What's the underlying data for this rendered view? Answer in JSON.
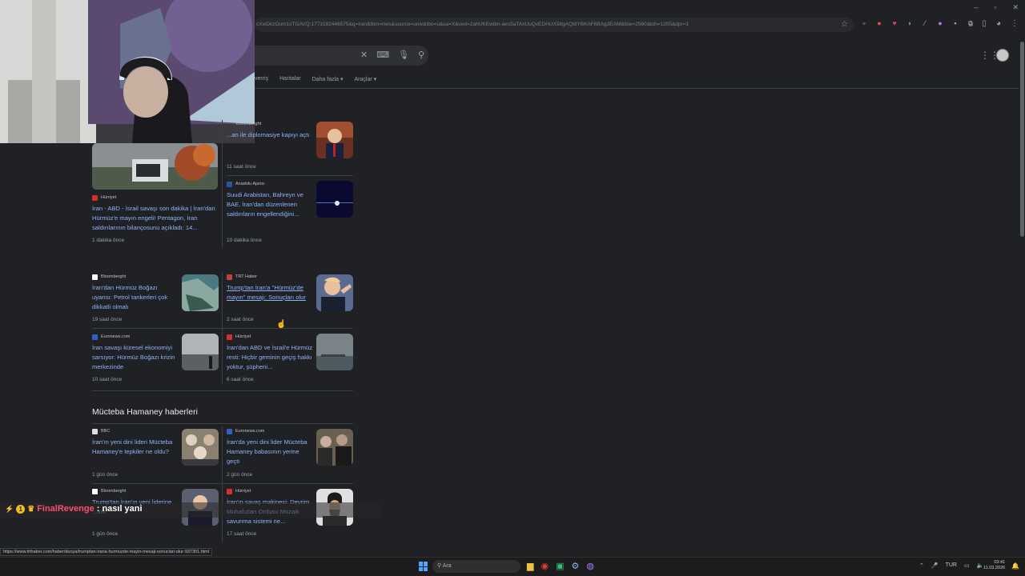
{
  "browser": {
    "address_url": "cXwDkzOum1sTGAVQ:1773182446575&q=iran&tbm=nws&source=univ&tbo=u&sa=X&ved=2ahUKEwibn-aes5aTAxUuQvEDHUX58gAQt8YBKAF6BAg3EAM&biw=2560&bih=1305&dpr=1",
    "window_controls": [
      "–",
      "▫",
      "✕"
    ]
  },
  "search": {
    "clear_icon": "close-icon",
    "tabs": [
      "verriş",
      "Haritalar",
      "Daha fazla ▾",
      "Araçlar ▾"
    ]
  },
  "cards": [
    {
      "source": "Bloomberght",
      "title": "...an ile diplomasiye kapıyı açtı",
      "time": "11 saat önce"
    },
    {
      "source": "Hürriyet",
      "title": "İran - ABD - İsrail savaşı son dakika | İran'dan Hürmüz'e mayın engeli! Pentagon, İran saldırılarının bilançosunu açıkladı: 14...",
      "time": "1 dakika önce"
    },
    {
      "source": "Anadolu Ajansı",
      "title": "Suudi Arabistan, Bahreyn ve BAE, İran'dan düzenlenen saldırıların engellendiğini...",
      "time": "10 dakika önce"
    },
    {
      "source": "Bloomberght",
      "title": "İran'dan Hürmüz Boğazı uyarısı: Petrol tankerleri çok dikkatli olmalı",
      "time": "19 saat önce"
    },
    {
      "source": "TRT Haber",
      "title": "Trump'tan İran'a \"Hürmüz'de mayın\" mesajı: Sonuçları olur",
      "time": "2 saat önce"
    },
    {
      "source": "Euronews.com",
      "title": "İran savaşı küresel ekonomiyi sarsıyor: Hürmüz Boğazı krizin merkezinde",
      "time": "10 saat önce"
    },
    {
      "source": "Hürriyet",
      "title": "İran'dan ABD ve İsrail'e Hürmüz resti: Hiçbir geminin geçiş hakkı yoktur, şüpheni...",
      "time": "6 saat önce"
    },
    {
      "source": "BBC",
      "title": "İran'ın yeni dini lideri Mücteba Hamaney'e tepkiler ne oldu?",
      "time": "1 gün önce"
    },
    {
      "source": "Euronews.com",
      "title": "İran'da yeni dini lider Mücteba Hamaney babasının yerine geçti",
      "time": "2 gün önce"
    },
    {
      "source": "Bloomberght",
      "title": "Trump'tan İran'ın yeni liderine ...ıım",
      "time": "1 gün önce"
    },
    {
      "source": "Hürriyet",
      "title": "İran'ın savaş makinesi: Devrim Muhafızları Ordusu Mozaik savunma sistemi ne...",
      "time": "17 saat önce"
    }
  ],
  "section2_title": "Mücteba Hamaney haberleri",
  "chat": {
    "badge": "1",
    "user": "FinalRevenge",
    "message": ": nasıl yani"
  },
  "status_url": "https://www.trthaber.com/haber/dunya/trumptan-irana-hurmuzde-mayin-mesaji-sonuclari-olur-937301.html",
  "taskbar": {
    "search_label": "Ara",
    "lang": "TUR",
    "time": "03:41",
    "date": "11.03.2026"
  },
  "colors": {
    "link": "#8ab4f8",
    "bg": "#202124",
    "chat_user": "#ff4d6d"
  }
}
